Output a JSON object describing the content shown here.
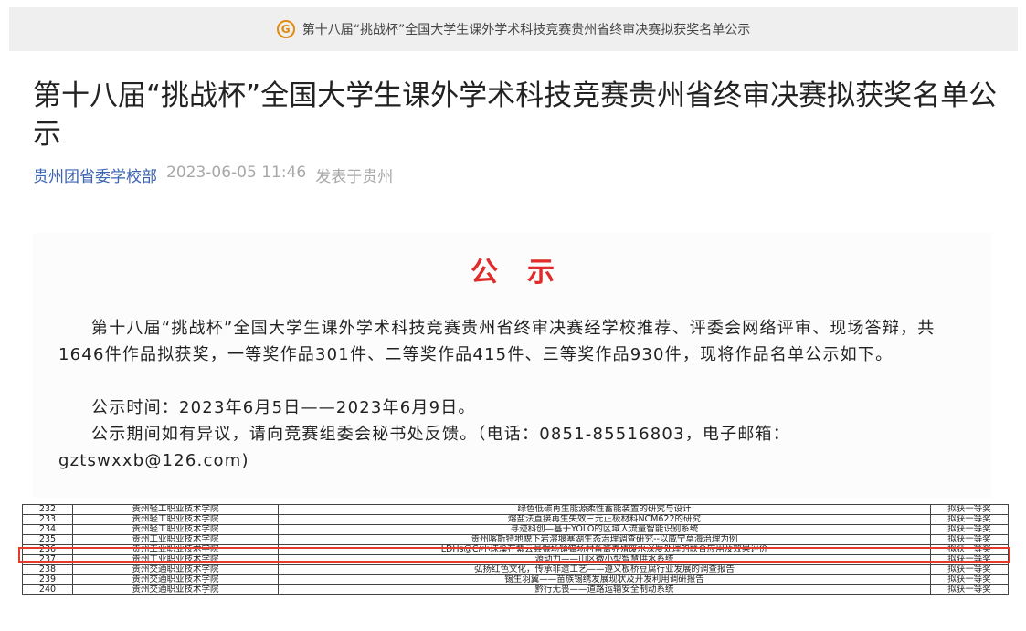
{
  "topbar": {
    "title": "第十八届“挑战杯”全国大学生课外学术科技竞赛贵州省终审决赛拟获奖名单公示"
  },
  "article": {
    "title": "第十八届“挑战杯”全国大学生课外学术科技竞赛贵州省终审决赛拟获奖名单公示",
    "source": "贵州团省委学校部",
    "time": "2023-06-05 11:46",
    "location": "发表于贵州"
  },
  "notice": {
    "heading": "公示",
    "p1": "第十八届“挑战杯”全国大学生课外学术科技竞赛贵州省终审决赛经学校推荐、评委会网络评审、现场答辩，共1646件作品拟获奖，一等奖作品301件、二等奖作品415件、三等奖作品930件，现将作品名单公示如下。",
    "p2": "公示时间：2023年6月5日——2023年6月9日。",
    "p3": "公示期间如有异议，请向竞赛组委会秘书处反馈。（电话：0851-85516803，电子邮箱：gztswxxb@126.com)"
  },
  "table": {
    "highlight_row": "235",
    "rows": [
      {
        "no": "232",
        "school": "贵州轻工职业技术学院",
        "project": "绿色低碳再生能源柔性蓄能装置的研究与设计",
        "award": "拟获一等奖"
      },
      {
        "no": "233",
        "school": "贵州轻工职业技术学院",
        "project": "熔盐法直接再生失效三元正极材料NCM622的研究",
        "award": "拟获一等奖"
      },
      {
        "no": "234",
        "school": "贵州轻工职业技术学院",
        "project": "寻迹科创—基于YOLO的区域人流量智能识别系统",
        "award": "拟获一等奖"
      },
      {
        "no": "235",
        "school": "贵州工业职业技术学院",
        "project": "贵州喀斯特地貌下岩溶堰塞湖生态治理调查研究--以威宁草海治理为例",
        "award": "拟获一等奖"
      },
      {
        "no": "236",
        "school": "贵州工业职业技术学院",
        "project": "LDHs@C/小球藻在紫云县猴场镇猫场村畜禽养殖废水深度处理的联合应用及效果评价",
        "award": "拟获一等奖"
      },
      {
        "no": "237",
        "school": "贵州工业职业技术学院",
        "project": "源动力——山区微小型智慧供水系统",
        "award": "拟获一等奖"
      },
      {
        "no": "238",
        "school": "贵州交通职业技术学院",
        "project": "弘扬红色文化，传承非遗工艺——遵义板桥豆腐行业发展的调查报告",
        "award": "拟获一等奖"
      },
      {
        "no": "239",
        "school": "贵州交通职业技术学院",
        "project": "锡生羽翼——苗族锡绣发展现状及开发利用调研报告",
        "award": "拟获一等奖"
      },
      {
        "no": "240",
        "school": "贵州交通职业技术学院",
        "project": "黔行无畏——道路运输安全制动系统",
        "award": "拟获一等奖"
      }
    ]
  }
}
